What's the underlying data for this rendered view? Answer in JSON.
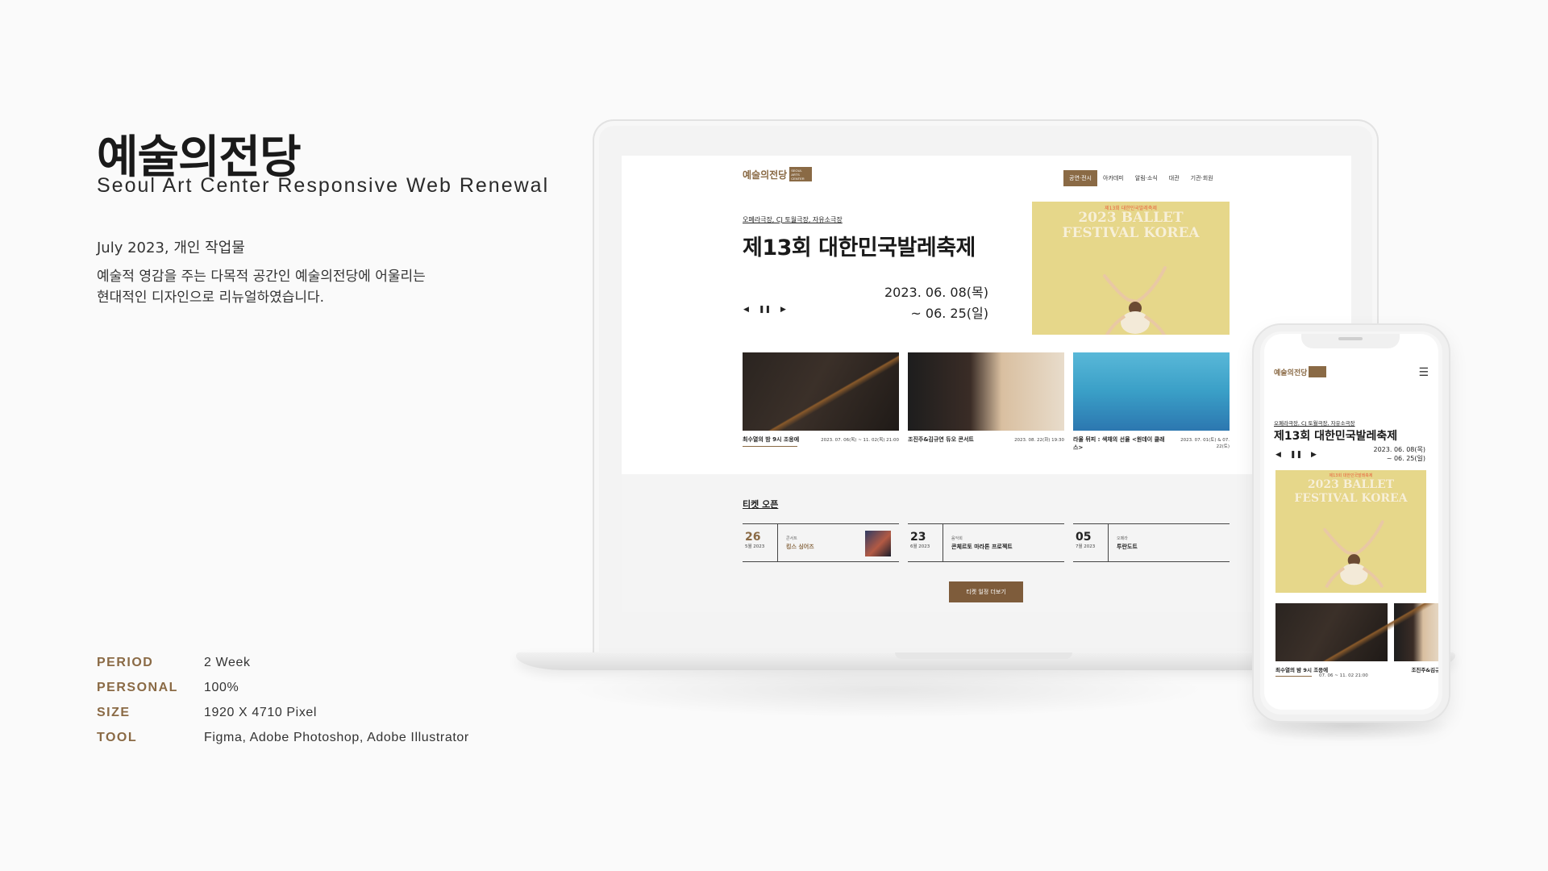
{
  "intro": {
    "title_ko": "예술의전당",
    "title_en": "Seoul Art Center Responsive Web Renewal",
    "date_line": "July 2023,  개인 작업물",
    "desc_line1": "예술적 영감을 주는 다목적 공간인 예술의전당에 어울리는",
    "desc_line2": "현대적인 디자인으로 리뉴얼하였습니다."
  },
  "meta": [
    {
      "key": "PERIOD",
      "value": "2 Week"
    },
    {
      "key": "PERSONAL",
      "value": "100%"
    },
    {
      "key": "SIZE",
      "value": "1920 X 4710 Pixel"
    },
    {
      "key": "TOOL",
      "value": "Figma, Adobe Photoshop, Adobe Illustrator"
    }
  ],
  "site": {
    "logo_text": "예술의전당",
    "logo_mark": "SEOUL ARTS CENTER",
    "nav": [
      "공연·전시",
      "아카데미",
      "알림·소식",
      "대관",
      "기관·회원"
    ],
    "hero": {
      "venue": "오페라극장, CJ 토월극장, 자유소극장",
      "title": "제13회 대한민국발레축제",
      "date_start": "2023. 06. 08(목)",
      "date_end": "~ 06. 25(일)",
      "ctrl_prev": "◀",
      "ctrl_pause": "❚❚",
      "ctrl_next": "▶",
      "poster_sub": "제13회 대한민국발레축제",
      "poster_title_1": "2023 BALLET",
      "poster_title_2": "FESTIVAL KOREA"
    },
    "cards": [
      {
        "name": "최수열의 밤 9시 조응에",
        "date": "2023. 07. 06(목) ~ 11. 02(목) 21:00"
      },
      {
        "name": "조진주&김규연 듀오 콘서트",
        "date": "2023. 08. 22(화) 19:30"
      },
      {
        "name": "라울 뒤피 : 색채의 선율 <원데이 클래스>",
        "date": "2023. 07. 01(토) & 07. 22(토)"
      }
    ],
    "ticket_title": "티켓 오픈",
    "tickets": [
      {
        "day": "26",
        "month": "5월 2023",
        "cat": "콘서트",
        "name": "킹스 싱어즈",
        "thumb": "The King's Singers"
      },
      {
        "day": "23",
        "month": "6월 2023",
        "cat": "음악회",
        "name": "콘체르토 마라톤 프로젝트"
      },
      {
        "day": "05",
        "month": "7월 2023",
        "cat": "오페라",
        "name": "투란도트"
      }
    ],
    "more_button": "티켓 일정 더보기"
  },
  "mobile": {
    "logo_text": "예술의전당",
    "menu_icon": "☰",
    "venue": "오페라극장, CJ 토월극장, 자유소극장",
    "title": "제13회 대한민국발레축제",
    "date_start": "2023. 06. 08(목)",
    "date_end": "~ 06. 25(일)",
    "card1_name": "최수열의 밤 9시 조응에",
    "card2_name": "조진주&김규연",
    "card1_date": "07. 06 ~ 11. 02   21:00"
  },
  "colors": {
    "accent": "#8a6a45",
    "poster": "#e6d78a"
  }
}
